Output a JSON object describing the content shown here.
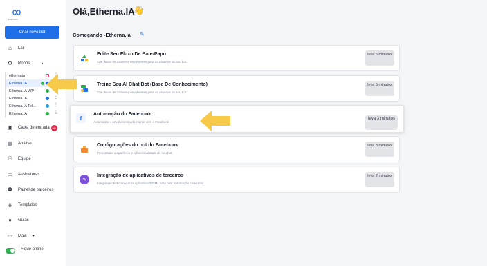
{
  "brand": {
    "logo_icon": "infinity-logo-icon",
    "logo_text": "Etherna IA"
  },
  "sidebar": {
    "create_button": "Criar novo bot",
    "nav_top": [
      {
        "icon": "home-icon",
        "label": "Lar"
      },
      {
        "icon": "robot-icon",
        "label": "Robôs"
      }
    ],
    "robots": [
      {
        "label": "ethernaia",
        "channel": "instagram",
        "color": "#e23d6b"
      },
      {
        "label": "Etherna.IA",
        "channel": "facebook",
        "color": "#1e6fe8",
        "active": true
      },
      {
        "label": "Etherna.IA WP",
        "channel": "whatsapp",
        "color": "#2bb24c"
      },
      {
        "label": "Etherna.IA",
        "channel": "webchat",
        "color": "#1e6fe8"
      },
      {
        "label": "Etherna.IA Tel...",
        "channel": "telegram",
        "color": "#2aa3e0"
      },
      {
        "label": "Etherna.IA",
        "channel": "whatsapp",
        "color": "#2bb24c"
      }
    ],
    "nav_bottom": [
      {
        "icon": "inbox-icon",
        "label": "Caixa de entrada"
      },
      {
        "icon": "chart-icon",
        "label": "Análise"
      },
      {
        "icon": "team-icon",
        "label": "Equipe"
      },
      {
        "icon": "subscription-icon",
        "label": "Assinaturas"
      },
      {
        "icon": "partners-icon",
        "label": "Painel de parceiros"
      },
      {
        "icon": "layers-icon",
        "label": "Templates"
      },
      {
        "icon": "bulb-icon",
        "label": "Guias"
      },
      {
        "icon": "more-icon",
        "label": "Mais"
      }
    ],
    "inbox_badge": "99+",
    "online_label": "Fique online"
  },
  "main": {
    "greeting": "Olá,Etherna.IA",
    "greeting_emoji": "👋",
    "section_title": "Começando -Etherna.Ia",
    "cards": [
      {
        "icon": "flow-icon",
        "title": "Edite Seu Fluxo De Bate-Papo",
        "desc": "Crie fluxos de conversa envolventes para os usuários do seu bot.",
        "time": "leva 5 minutos"
      },
      {
        "icon": "chatbot-icon",
        "title": "Treine Seu AI Chat Bot (Base De Conhecimento)",
        "desc": "Crie fluxos de conversa envolventes para os usuários do seu bot.",
        "time": "leva 5 minutos"
      },
      {
        "icon": "facebook-automation-icon",
        "title": "Automação do Facebook",
        "desc": "Automatize o envolvimento do cliente com o Facebook",
        "time": "leva 3 minutos",
        "active": true
      },
      {
        "icon": "settings-icon",
        "title": "Configurações do bot do Facebook",
        "desc": "Personalize a aparência e a funcionalidade do seu bot.",
        "time": "leva 3 minutos"
      },
      {
        "icon": "integration-icon",
        "title": "Integração de aplicativos de terceiros",
        "desc": "Integre seu bot com outros aplicativos/CRMs para criar automação comercial.",
        "time": "leva 2 minutos"
      }
    ]
  },
  "colors": {
    "accent": "#1e6fe8",
    "arrow": "#f7c948",
    "online": "#2bb24c",
    "badge": "#e0294a"
  }
}
